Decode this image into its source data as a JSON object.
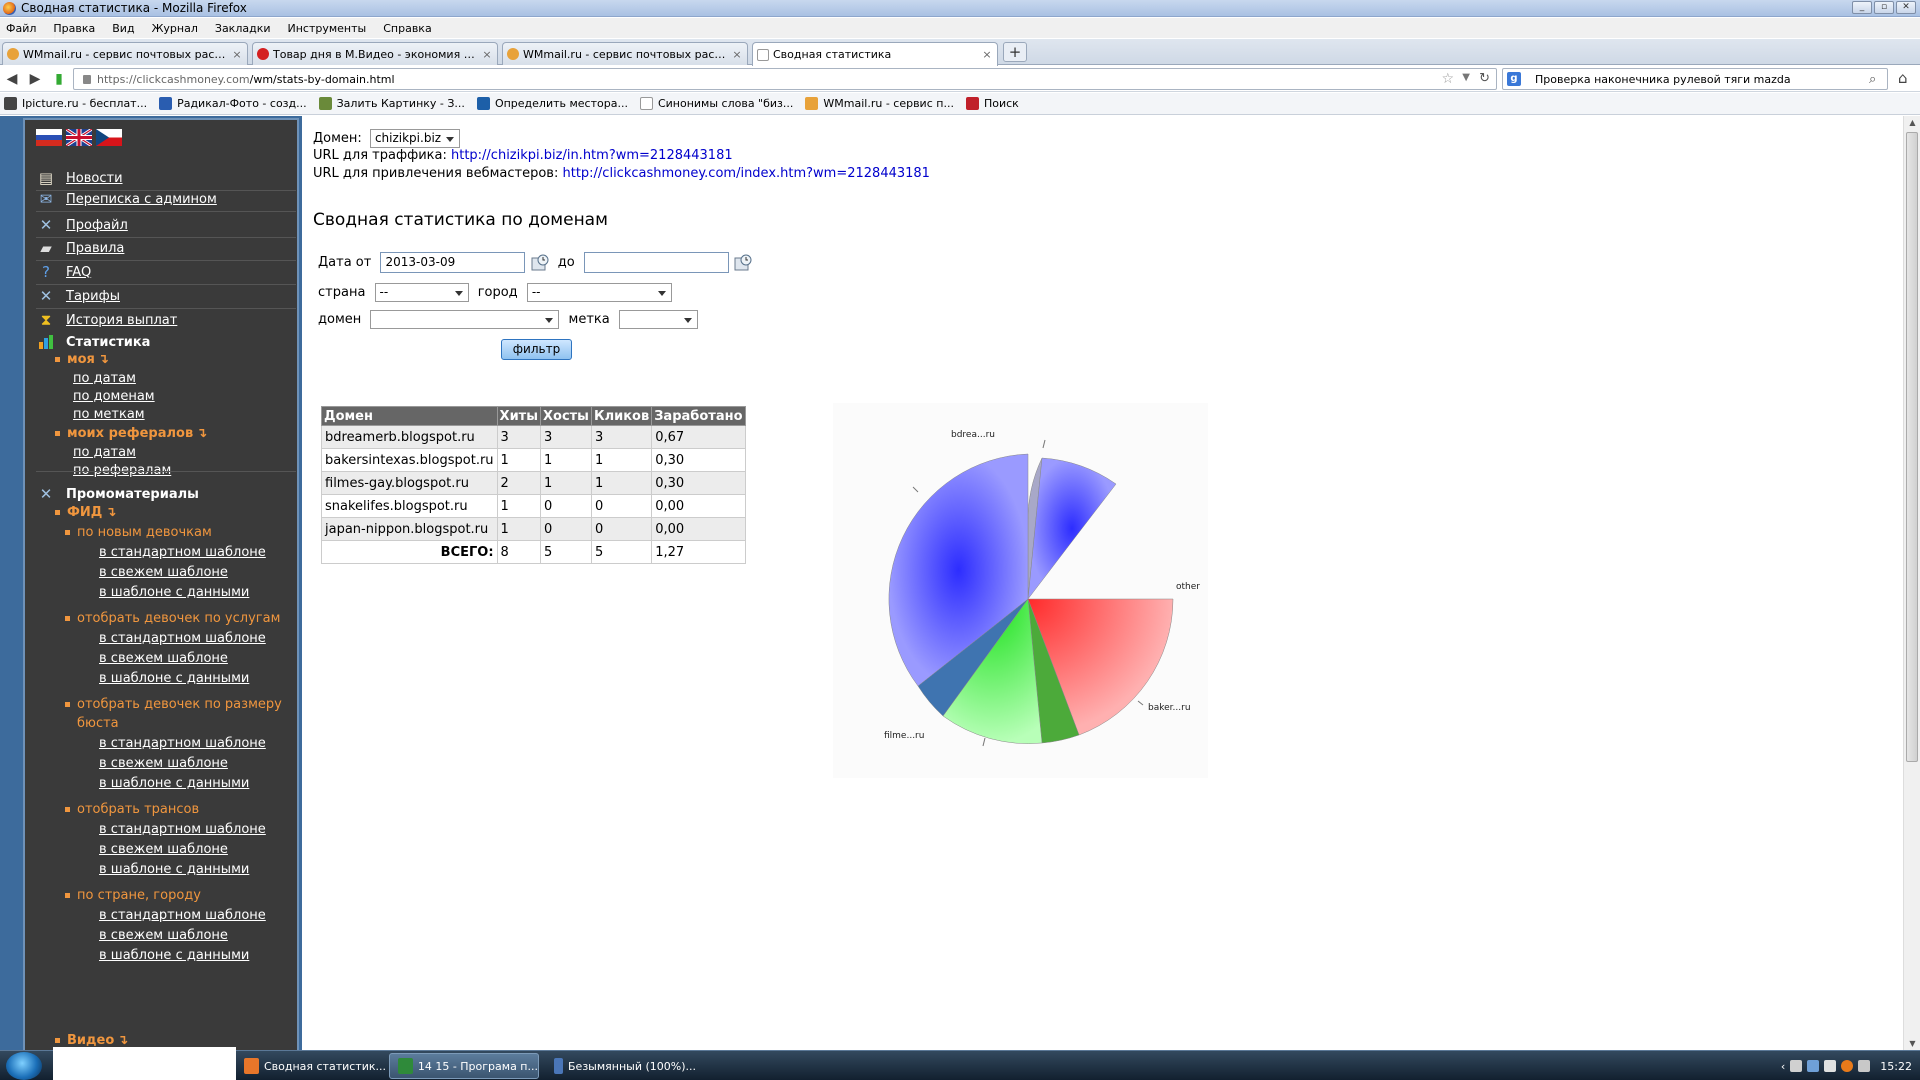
{
  "window": {
    "title": "Сводная статистика - Mozilla Firefox"
  },
  "menu": [
    "Файл",
    "Правка",
    "Вид",
    "Журнал",
    "Закладки",
    "Инструменты",
    "Справка"
  ],
  "tabs": [
    {
      "label": "WMmail.ru - сервис почтовых рассылок...",
      "icon_color": "#e8a23a"
    },
    {
      "label": "Товар дня в М.Видео - экономия 6000 ...",
      "icon_color": "#d42020"
    },
    {
      "label": "WMmail.ru - сервис почтовых рассылок...",
      "icon_color": "#e8a23a"
    },
    {
      "label": "Сводная статистика",
      "icon_color": "#ffffff"
    }
  ],
  "nav": {
    "url_host": "https://clickcashmoney.com",
    "url_path": "/wm/stats-by-domain.html",
    "search_query": "Проверка наконечника рулевой тяги mazda"
  },
  "bookmarks": [
    {
      "label": "Ipicture.ru - бесплат...",
      "color": "#444"
    },
    {
      "label": "Радикал-Фото - созд...",
      "color": "#2a5db0"
    },
    {
      "label": "Залить Картинку - З...",
      "color": "#6a8a3a"
    },
    {
      "label": "Определить местора...",
      "color": "#1d5fa8"
    },
    {
      "label": "Синонимы слова \"биз...",
      "color": "#ffffff"
    },
    {
      "label": "WMmail.ru - сервис п...",
      "color": "#e8a23a"
    },
    {
      "label": "Поиск",
      "color": "#c0202a"
    }
  ],
  "sidebar": {
    "menu": [
      {
        "label": "Новости",
        "icon": "newspaper-icon"
      },
      {
        "label": "Переписка с админом",
        "icon": "mail-icon"
      },
      {
        "label": "Профайл",
        "icon": "tools-icon"
      },
      {
        "label": "Правила",
        "icon": "book-icon"
      },
      {
        "label": "FAQ",
        "icon": "help-icon"
      },
      {
        "label": "Тарифы",
        "icon": "tools-icon"
      },
      {
        "label": "История выплат",
        "icon": "hourglass-icon"
      }
    ],
    "stats": {
      "heading": "Статистика",
      "mine": "моя",
      "mine_links": [
        "по датам",
        "по доменам",
        "по меткам"
      ],
      "refs": "моих рефералов",
      "refs_links": [
        "по датам",
        "по рефералам"
      ]
    },
    "promo": {
      "heading": "Промоматериалы",
      "feed": "ФИД",
      "groups": [
        {
          "label": "по новым девочкам",
          "links": [
            "в стандартном шаблоне",
            "в свежем шаблоне",
            "в шаблоне с данными"
          ]
        },
        {
          "label": "отобрать девочек по услугам",
          "links": [
            "в стандартном шаблоне",
            "в свежем шаблоне",
            "в шаблоне с данными"
          ]
        },
        {
          "label": "отобрать девочек по размеру",
          "label2": "бюста",
          "links": [
            "в стандартном шаблоне",
            "в свежем шаблоне",
            "в шаблоне с данными"
          ]
        },
        {
          "label": "отобрать трансов",
          "links": [
            "в стандартном шаблоне",
            "в свежем шаблоне",
            "в шаблоне с данными"
          ]
        },
        {
          "label": "по стране, городу",
          "links": [
            "в стандартном шаблоне",
            "в свежем шаблоне",
            "в шаблоне с данными"
          ]
        }
      ],
      "video": "Видео"
    }
  },
  "content": {
    "domain_label": "Домен:",
    "domain_value": "chizikpi.biz",
    "traffic_label": "URL для траффика:",
    "traffic_url": "http://chizikpi.biz/in.htm?wm=2128443181",
    "webmaster_label": "URL для привлечения вебмастеров:",
    "webmaster_url": "http://clickcashmoney.com/index.htm?wm=2128443181",
    "heading": "Сводная статистика по доменам",
    "filters": {
      "date_from_label": "Дата от",
      "date_from": "2013-03-09",
      "date_to_label": "до",
      "date_to": "",
      "country_label": "страна",
      "country": "--",
      "city_label": "город",
      "city": "--",
      "domain_label": "домен",
      "domain": "",
      "tag_label": "метка",
      "tag": "",
      "button": "фильтр"
    },
    "table": {
      "columns": [
        "Домен",
        "Хиты",
        "Хосты",
        "Кликов",
        "Заработано"
      ],
      "rows": [
        [
          "bdreamerb.blogspot.ru",
          "3",
          "3",
          "3",
          "0,67"
        ],
        [
          "bakersintexas.blogspot.ru",
          "1",
          "1",
          "1",
          "0,30"
        ],
        [
          "filmes-gay.blogspot.ru",
          "2",
          "1",
          "1",
          "0,30"
        ],
        [
          "snakelifes.blogspot.ru",
          "1",
          "0",
          "0",
          "0,00"
        ],
        [
          "japan-nippon.blogspot.ru",
          "1",
          "0",
          "0",
          "0,00"
        ]
      ],
      "total_label": "ВСЕГО:",
      "total": [
        "8",
        "5",
        "5",
        "1,27"
      ]
    },
    "pie_labels": [
      "bdrea...ru",
      "other",
      "baker...ru",
      "filme...ru"
    ]
  },
  "taskbar": {
    "tasks": [
      {
        "label": "Сводная статистик...",
        "icon_color": "#e8762a"
      },
      {
        "label": "14 15 - Програма п...",
        "icon_color": "#2f8a3a"
      },
      {
        "label": "Безымянный (100%)...",
        "icon_color": "#4a76b8"
      }
    ],
    "clock": "15:22"
  }
}
